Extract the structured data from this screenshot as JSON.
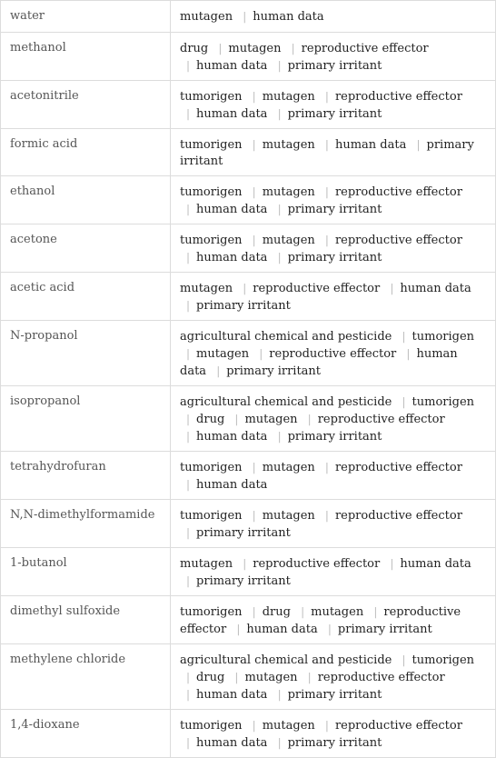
{
  "rows": [
    {
      "name": "water",
      "props": [
        "mutagen",
        "human data"
      ],
      "lines": 1
    },
    {
      "name": "methanol",
      "props": [
        "drug",
        "mutagen",
        "reproductive effector",
        "human data",
        "primary irritant"
      ],
      "lines": 2
    },
    {
      "name": "acetonitrile",
      "props": [
        "tumorigen",
        "mutagen",
        "reproductive effector",
        "human data",
        "primary irritant"
      ],
      "lines": 2
    },
    {
      "name": "formic acid",
      "props": [
        "tumorigen",
        "mutagen",
        "human data",
        "primary irritant"
      ],
      "lines": 2
    },
    {
      "name": "ethanol",
      "props": [
        "tumorigen",
        "mutagen",
        "reproductive effector",
        "human data",
        "primary irritant"
      ],
      "lines": 2
    },
    {
      "name": "acetone",
      "props": [
        "tumorigen",
        "mutagen",
        "reproductive effector",
        "human data",
        "primary irritant"
      ],
      "lines": 2
    },
    {
      "name": "acetic acid",
      "props": [
        "mutagen",
        "reproductive effector",
        "human data",
        "primary irritant"
      ],
      "lines": 2
    },
    {
      "name": "N-propanol",
      "props": [
        "agricultural chemical and pesticide",
        "tumorigen",
        "mutagen",
        "reproductive effector",
        "human data",
        "primary irritant"
      ],
      "lines": 3
    },
    {
      "name": "isopropanol",
      "props": [
        "agricultural chemical and pesticide",
        "tumorigen",
        "drug",
        "mutagen",
        "reproductive effector",
        "human data",
        "primary irritant"
      ],
      "lines": 3
    },
    {
      "name": "tetrahydrofuran",
      "props": [
        "tumorigen",
        "mutagen",
        "reproductive effector",
        "human data"
      ],
      "lines": 2
    },
    {
      "name": "N,N-dimethylformamide",
      "props": [
        "tumorigen",
        "mutagen",
        "reproductive effector",
        "primary irritant"
      ],
      "lines": 2
    },
    {
      "name": "1-butanol",
      "props": [
        "mutagen",
        "reproductive effector",
        "human data",
        "primary irritant"
      ],
      "lines": 2
    },
    {
      "name": "dimethyl sulfoxide",
      "props": [
        "tumorigen",
        "drug",
        "mutagen",
        "reproductive effector",
        "human data",
        "primary irritant"
      ],
      "lines": 2
    },
    {
      "name": "methylene chloride",
      "props": [
        "agricultural chemical and pesticide",
        "tumorigen",
        "drug",
        "mutagen",
        "reproductive effector",
        "human data",
        "primary irritant"
      ],
      "lines": 3
    },
    {
      "name": "1,4-dioxane",
      "props": [
        "tumorigen",
        "mutagen",
        "reproductive effector",
        "human data",
        "primary irritant"
      ],
      "lines": 2
    }
  ],
  "separator": "|"
}
